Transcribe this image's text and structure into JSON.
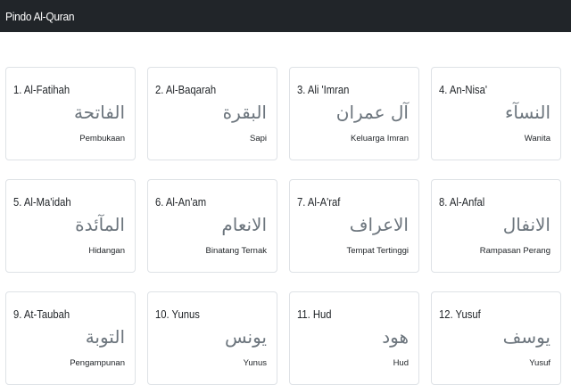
{
  "navbar": {
    "brand": "Pindo Al-Quran"
  },
  "surahs": [
    {
      "name": "1. Al-Fatihah",
      "arabic": "الفاتحة",
      "meaning": "Pembukaan"
    },
    {
      "name": "2. Al-Baqarah",
      "arabic": "البقرة",
      "meaning": "Sapi"
    },
    {
      "name": "3. Ali 'Imran",
      "arabic": "آل عمران",
      "meaning": "Keluarga Imran"
    },
    {
      "name": "4. An-Nisa'",
      "arabic": "النسآء",
      "meaning": "Wanita"
    },
    {
      "name": "5. Al-Ma'idah",
      "arabic": "المآئدة",
      "meaning": "Hidangan"
    },
    {
      "name": "6. Al-An'am",
      "arabic": "الانعام",
      "meaning": "Binatang Ternak"
    },
    {
      "name": "7. Al-A'raf",
      "arabic": "الاعراف",
      "meaning": "Tempat Tertinggi"
    },
    {
      "name": "8. Al-Anfal",
      "arabic": "الانفال",
      "meaning": "Rampasan Perang"
    },
    {
      "name": "9. At-Taubah",
      "arabic": "التوبة",
      "meaning": "Pengampunan"
    },
    {
      "name": "10. Yunus",
      "arabic": "يونس",
      "meaning": "Yunus"
    },
    {
      "name": "11. Hud",
      "arabic": "هود",
      "meaning": "Hud"
    },
    {
      "name": "12. Yusuf",
      "arabic": "يوسف",
      "meaning": "Yusuf"
    }
  ]
}
